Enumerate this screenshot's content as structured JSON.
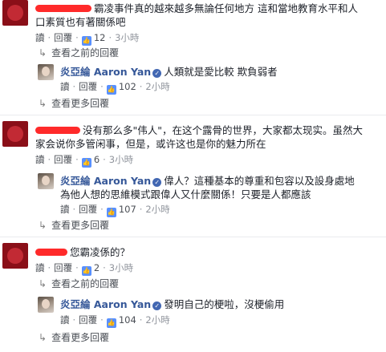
{
  "colors": {
    "link": "#365899",
    "meta": "#90949c",
    "like_blue": "#5890ff",
    "redact": "#ff2a2a"
  },
  "labels": {
    "reply_action": "讀",
    "reply": "回覆",
    "view_previous": "查看之前的回覆",
    "view_more": "查看更多回覆",
    "sep": "·",
    "like_icon": "thumbs-up-icon",
    "arrow_icon": "reply-arrow-icon"
  },
  "replier": {
    "name": "炎亞綸 Aaron Yan"
  },
  "threads": [
    {
      "comment": {
        "text_line1": "霸凌事件真的越來越多無論任何地方 這和當地教育水平和人",
        "text_line2": "口素質也有著關係吧",
        "likes": "12",
        "time": "3小時"
      },
      "reply": {
        "text_line1": "人類就是愛比較 欺負弱者",
        "text_line2": "",
        "likes": "102",
        "time": "2小時"
      }
    },
    {
      "comment": {
        "text_line1": "没有那么多\"伟人\"，在这个露骨的世界，大家都太现实。虽然大",
        "text_line2": "家会说你多管闲事，但是，或许这也是你的魅力所在",
        "likes": "6",
        "time": "3小時"
      },
      "reply": {
        "text_line1": "偉人？這種基本的尊重和包容以及設身處地",
        "text_line2": "為他人想的思維模式跟偉人又什麼關係！只要是人都應該",
        "likes": "107",
        "time": "2小時"
      }
    },
    {
      "comment": {
        "text_line1": "您霸凌係的？",
        "text_line2": "",
        "likes": "2",
        "time": "3小時"
      },
      "reply": {
        "text_line1": "發明自己的梗啦，沒梗偷用",
        "text_line2": "",
        "likes": "104",
        "time": "2小時"
      }
    }
  ]
}
